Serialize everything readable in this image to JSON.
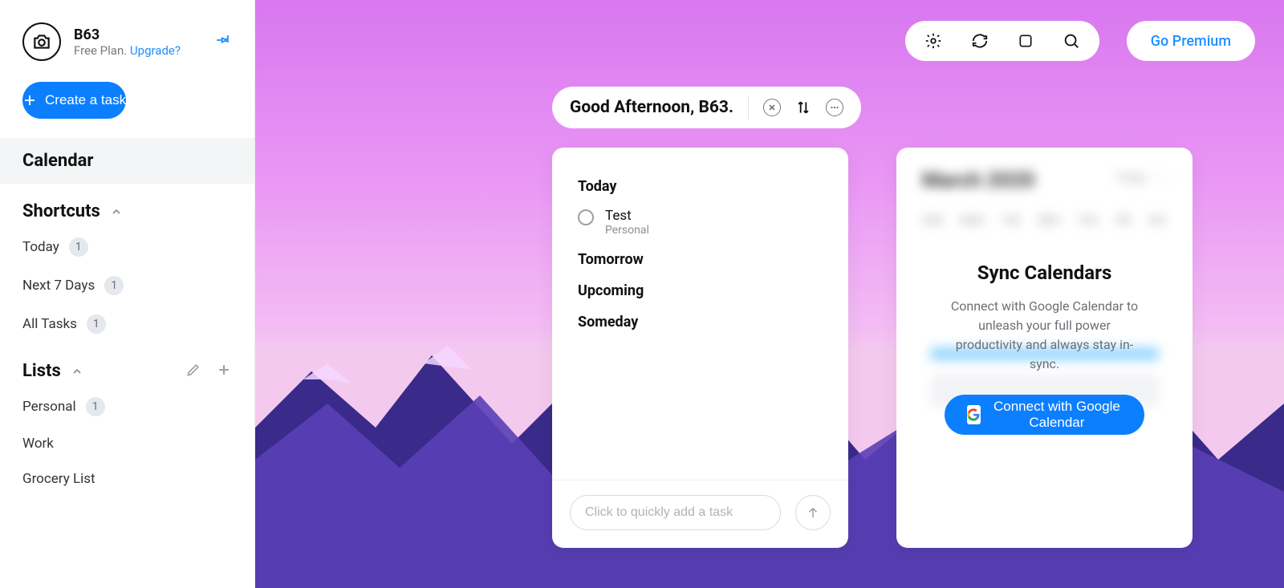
{
  "colors": {
    "accent": "#0c7fff",
    "link": "#1f8fff"
  },
  "profile": {
    "name": "B63",
    "plan_text": "Free Plan.",
    "upgrade_text": "Upgrade?"
  },
  "create_button": "Create a task",
  "nav": {
    "calendar": "Calendar",
    "shortcuts_label": "Shortcuts",
    "shortcuts": [
      {
        "label": "Today",
        "count": "1"
      },
      {
        "label": "Next 7 Days",
        "count": "1"
      },
      {
        "label": "All Tasks",
        "count": "1"
      }
    ],
    "lists_label": "Lists",
    "lists": [
      {
        "label": "Personal",
        "count": "1"
      },
      {
        "label": "Work",
        "count": ""
      },
      {
        "label": "Grocery List",
        "count": ""
      }
    ]
  },
  "topbar": {
    "premium": "Go Premium",
    "icons": [
      "gear-icon",
      "sync-icon",
      "view-icon",
      "search-icon"
    ]
  },
  "greeting": "Good Afternoon, B63.",
  "tasks": {
    "sections": {
      "today": "Today",
      "tomorrow": "Tomorrow",
      "upcoming": "Upcoming",
      "someday": "Someday"
    },
    "today_items": [
      {
        "title": "Test",
        "list": "Personal"
      }
    ],
    "quick_add_placeholder": "Click to quickly add a task"
  },
  "calendar_promo": {
    "title": "Sync Calendars",
    "body": "Connect with Google Calendar to unleash your full power productivity and always stay in-sync.",
    "button": "Connect with Google Calendar",
    "blur_month": "March 2020"
  }
}
